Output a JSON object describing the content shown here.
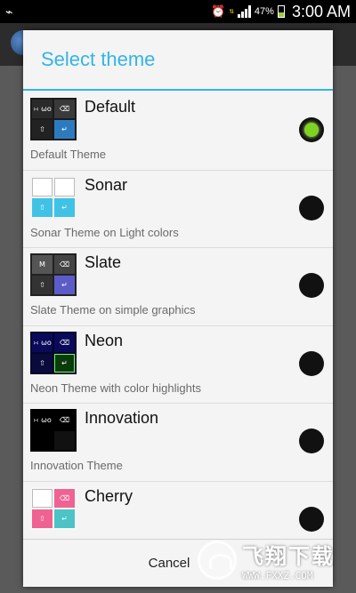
{
  "status_bar": {
    "battery": "47%",
    "time": "3:00 AM",
    "icons": [
      "usb-icon",
      "alarm-icon",
      "data-arrows-icon",
      "signal-icon",
      "battery-icon"
    ]
  },
  "dialog": {
    "title": "Select theme",
    "accent_color": "#33b5e5",
    "cancel_label": "Cancel",
    "selected_index": 0
  },
  "themes": [
    {
      "name": "Default",
      "description": "Default Theme",
      "selected": true,
      "thumb": "default"
    },
    {
      "name": "Sonar",
      "description": "Sonar Theme on Light colors",
      "selected": false,
      "thumb": "sonar"
    },
    {
      "name": "Slate",
      "description": "Slate Theme on simple graphics",
      "selected": false,
      "thumb": "slate"
    },
    {
      "name": "Neon",
      "description": "Neon Theme with color highlights",
      "selected": false,
      "thumb": "neon"
    },
    {
      "name": "Innovation",
      "description": "Innovation Theme",
      "selected": false,
      "thumb": "innovation"
    },
    {
      "name": "Cherry",
      "description": "",
      "selected": false,
      "thumb": "cherry"
    }
  ],
  "watermark": {
    "brand": "飞翔下载",
    "url": "WWW.FXXZ.COM"
  }
}
